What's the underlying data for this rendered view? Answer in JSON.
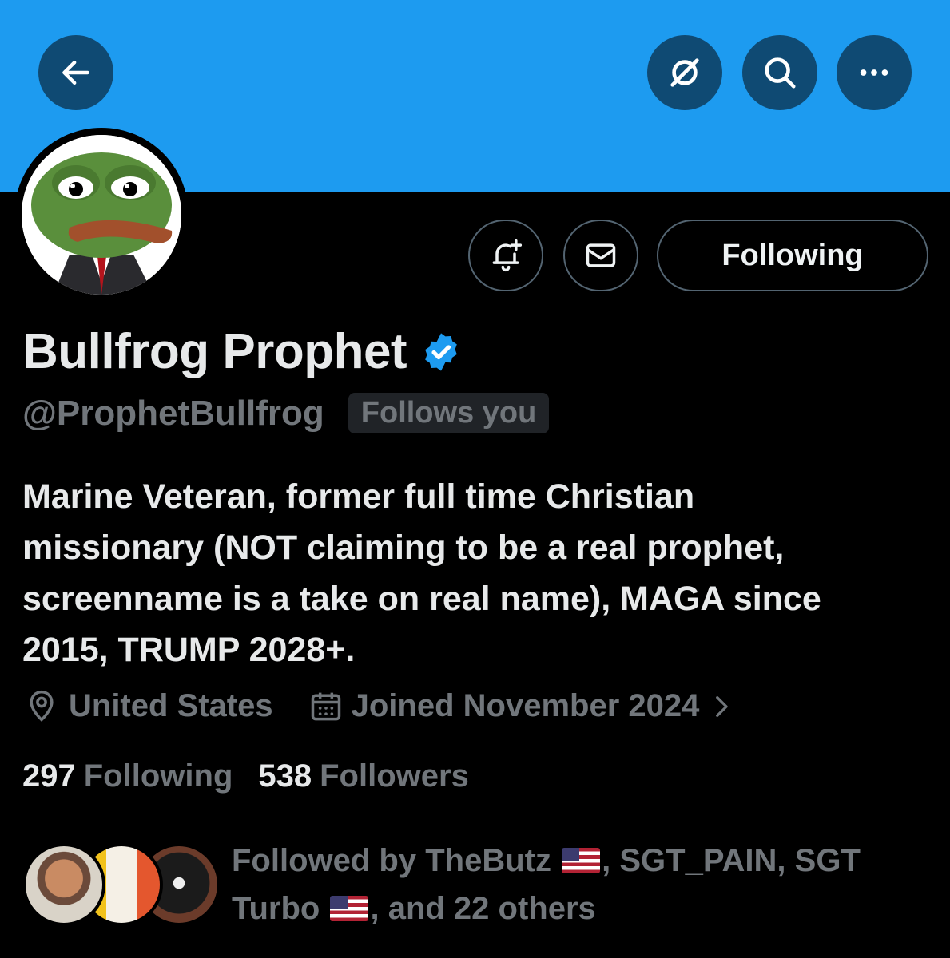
{
  "profile": {
    "name": "Bullfrog Prophet",
    "handle": "@ProphetBullfrog",
    "follows_you": "Follows you",
    "bio_lines": [
      "Marine Veteran, former full time Christian",
      "missionary (NOT claiming to be a real prophet,",
      "screenname is a take on real name), MAGA since",
      "2015, TRUMP 2028+."
    ],
    "location": "United States",
    "joined": "Joined November 2024",
    "following_count": "297",
    "following_label": "Following",
    "followers_count": "538",
    "followers_label": "Followers",
    "verified_icon": "verified-badge-icon"
  },
  "actions": {
    "following_button": "Following",
    "notify_icon": "bell-plus-icon",
    "message_icon": "envelope-icon"
  },
  "header": {
    "back_icon": "arrow-left-icon",
    "grok_icon": "grok-icon",
    "search_icon": "search-icon",
    "more_icon": "more-dots-icon"
  },
  "followed_by": {
    "prefix": "Followed by ",
    "user1": "TheButz",
    "sep1": ", SGT_PAIN, SGT",
    "user3": "Turbo",
    "suffix": ", and 22 others"
  },
  "colors": {
    "banner": "#1d9bf0",
    "background": "#000000",
    "verified": "#1d9bf0",
    "muted_text": "#71767b"
  }
}
